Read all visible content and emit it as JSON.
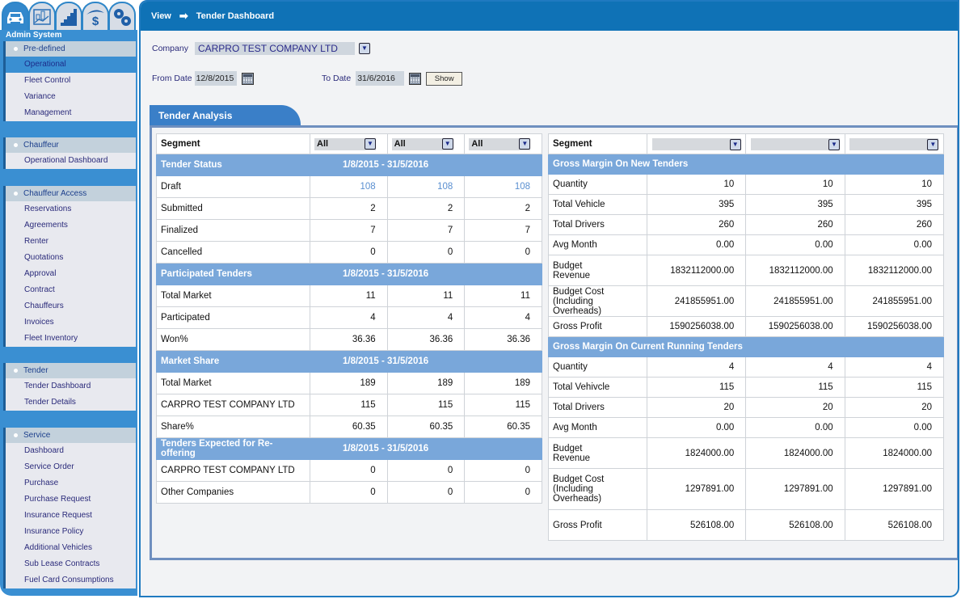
{
  "sidebar": {
    "tabs": [
      {
        "name": "car-icon",
        "active": true
      },
      {
        "name": "chart-icon",
        "active": false
      },
      {
        "name": "stairs-icon",
        "active": false
      },
      {
        "name": "dollar-icon",
        "active": false
      },
      {
        "name": "gears-icon",
        "active": false
      }
    ],
    "system_title": "Admin System",
    "groups": [
      {
        "title": "Pre-defined",
        "items": [
          "Operational",
          "Fleet Control",
          "Variance",
          "Management"
        ],
        "active_item": "Operational"
      },
      {
        "title": "Chauffeur",
        "items": [
          "Operational Dashboard"
        ]
      },
      {
        "title": "Chauffeur Access",
        "items": [
          "Reservations",
          "Agreements",
          "Renter",
          "Quotations",
          "Approval",
          "Contract",
          "Chauffeurs",
          "Invoices",
          "Fleet Inventory"
        ]
      },
      {
        "title": "Tender",
        "items": [
          "Tender Dashboard",
          "Tender Details"
        ]
      },
      {
        "title": "Service",
        "items": [
          "Dashboard",
          "Service Order",
          "Purchase",
          "Purchase Request",
          "Insurance Request",
          "Insurance Policy",
          "Additional Vehicles",
          "Sub Lease Contracts",
          "Fuel Card Consumptions"
        ]
      }
    ]
  },
  "header": {
    "breadcrumb_root": "View",
    "breadcrumb_arrow": "➡",
    "breadcrumb_current": "Tender Dashboard"
  },
  "filters": {
    "company_label": "Company",
    "company_value": "CARPRO TEST COMPANY LTD",
    "from_label": "From Date",
    "from_value": "12/8/2015",
    "to_label": "To Date",
    "to_value": "31/6/2016",
    "show_label": "Show"
  },
  "panel_title": "Tender Analysis",
  "left": {
    "segment_label": "Segment",
    "segment_selects": [
      "All",
      "All",
      "All"
    ],
    "sections": [
      {
        "title": "Tender Status",
        "period": "1/8/2015 - 31/5/2016",
        "rows": [
          {
            "label": "Draft",
            "values": [
              "108",
              "108",
              "108"
            ],
            "link": true
          },
          {
            "label": "Submitted",
            "values": [
              "2",
              "2",
              "2"
            ]
          },
          {
            "label": "Finalized",
            "values": [
              "7",
              "7",
              "7"
            ]
          },
          {
            "label": "Cancelled",
            "values": [
              "0",
              "0",
              "0"
            ]
          }
        ]
      },
      {
        "title": "Participated Tenders",
        "period": "1/8/2015 - 31/5/2016",
        "rows": [
          {
            "label": "Total Market",
            "values": [
              "11",
              "11",
              "11"
            ]
          },
          {
            "label": "Participated",
            "values": [
              "4",
              "4",
              "4"
            ]
          },
          {
            "label": "Won%",
            "values": [
              "36.36",
              "36.36",
              "36.36"
            ]
          }
        ]
      },
      {
        "title": "Market Share",
        "period": "1/8/2015 - 31/5/2016",
        "rows": [
          {
            "label": "Total Market",
            "values": [
              "189",
              "189",
              "189"
            ]
          },
          {
            "label": "CARPRO TEST COMPANY LTD",
            "values": [
              "115",
              "115",
              "115"
            ]
          },
          {
            "label": "Share%",
            "values": [
              "60.35",
              "60.35",
              "60.35"
            ]
          }
        ]
      },
      {
        "title": "Tenders Expected for Re-offering",
        "period": "1/8/2015 - 31/5/2016",
        "rows": [
          {
            "label": "CARPRO TEST COMPANY LTD",
            "values": [
              "0",
              "0",
              "0"
            ]
          },
          {
            "label": "Other Companies",
            "values": [
              "0",
              "0",
              "0"
            ]
          }
        ]
      }
    ]
  },
  "right": {
    "segment_label": "Segment",
    "segment_selects": [
      "",
      "",
      ""
    ],
    "sections": [
      {
        "title": "Gross Margin On New Tenders",
        "rows": [
          {
            "label": "Quantity",
            "values": [
              "10",
              "10",
              "10"
            ]
          },
          {
            "label": "Total Vehicle",
            "values": [
              "395",
              "395",
              "395"
            ]
          },
          {
            "label": "Total Drivers",
            "values": [
              "260",
              "260",
              "260"
            ]
          },
          {
            "label": "Avg Month",
            "values": [
              "0.00",
              "0.00",
              "0.00"
            ]
          },
          {
            "label": "Budget\nRevenue",
            "values": [
              "1832112000.00",
              "1832112000.00",
              "1832112000.00"
            ]
          },
          {
            "label": "Budget Cost\n(Including Overheads)",
            "values": [
              "241855951.00",
              "241855951.00",
              "241855951.00"
            ]
          },
          {
            "label": "Gross Profit",
            "values": [
              "1590256038.00",
              "1590256038.00",
              "1590256038.00"
            ]
          }
        ]
      },
      {
        "title": "Gross Margin On Current Running Tenders",
        "rows": [
          {
            "label": "Quantity",
            "values": [
              "4",
              "4",
              "4"
            ]
          },
          {
            "label": "Total Vehivcle",
            "values": [
              "115",
              "115",
              "115"
            ]
          },
          {
            "label": "Total Drivers",
            "values": [
              "20",
              "20",
              "20"
            ]
          },
          {
            "label": "Avg Month",
            "values": [
              "0.00",
              "0.00",
              "0.00"
            ]
          },
          {
            "label": "Budget\nRevenue",
            "values": [
              "1824000.00",
              "1824000.00",
              "1824000.00"
            ]
          },
          {
            "label": "Budget Cost\n(Including\nOverheads)",
            "values": [
              "1297891.00",
              "1297891.00",
              "1297891.00"
            ]
          },
          {
            "label": "Gross Profit",
            "values": [
              "526108.00",
              "526108.00",
              "526108.00"
            ]
          }
        ]
      }
    ]
  }
}
